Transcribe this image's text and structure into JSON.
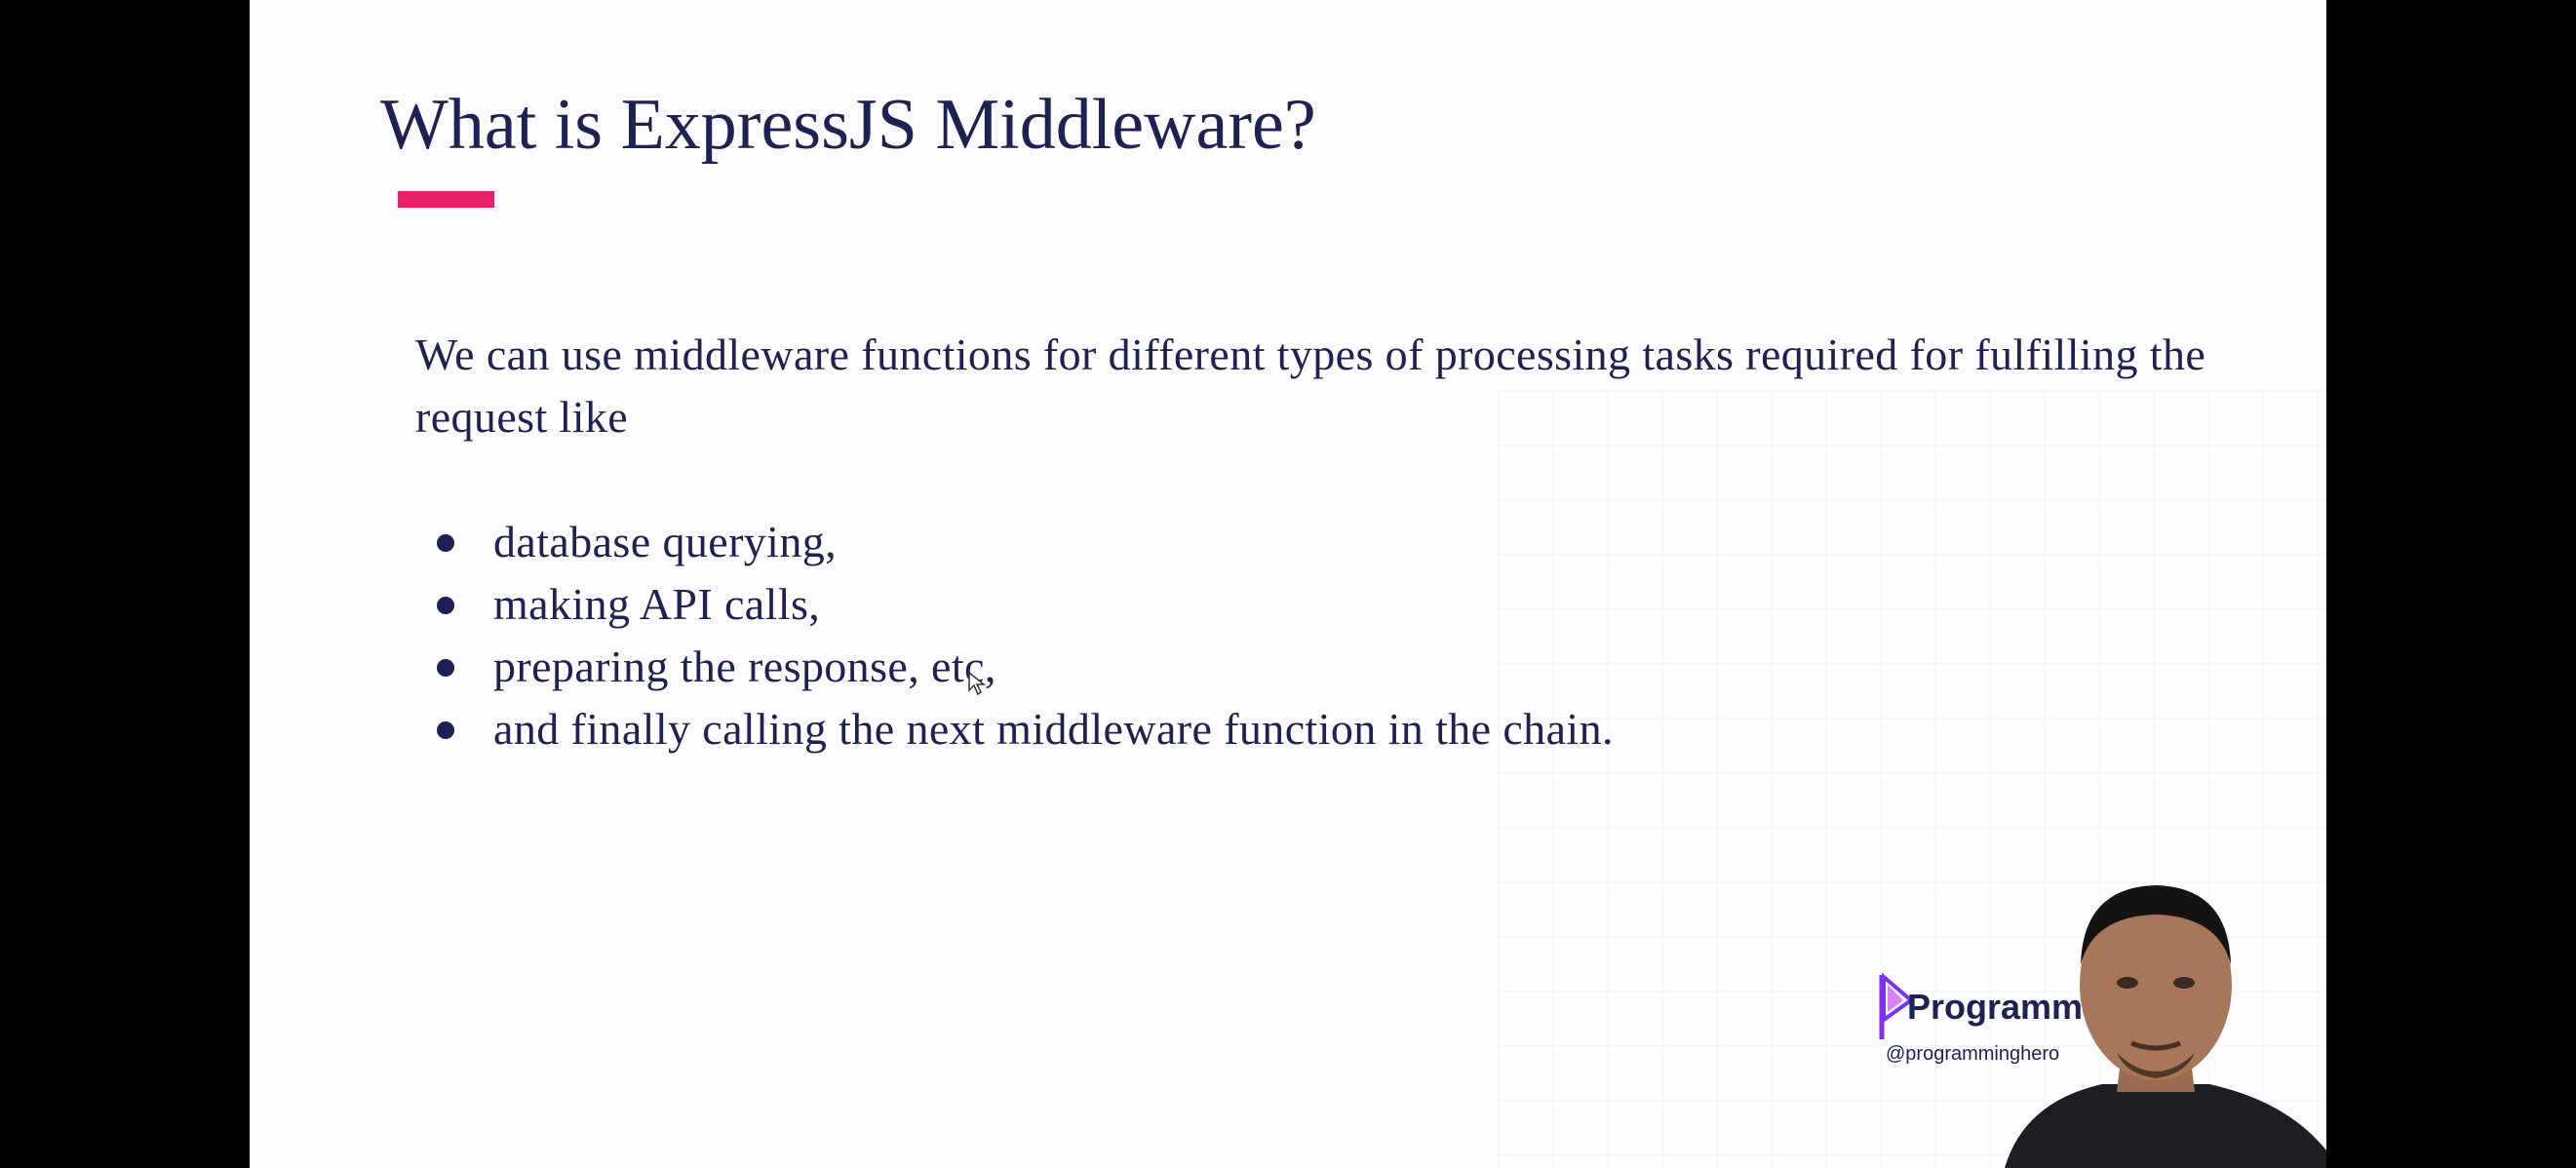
{
  "slide": {
    "title": "What is ExpressJS Middleware?",
    "intro": "We can use middleware functions for different types of processing tasks required for fulfilling the request like",
    "bullets": [
      "database querying,",
      "making API calls,",
      "preparing the response, etc,",
      "and finally calling the next middleware function in the chain."
    ]
  },
  "brand": {
    "name": "Programmi",
    "handle": "@programminghero"
  },
  "colors": {
    "text": "#1c2254",
    "accent": "#ea1f6b",
    "brand_purple": "#7b2ff7"
  }
}
